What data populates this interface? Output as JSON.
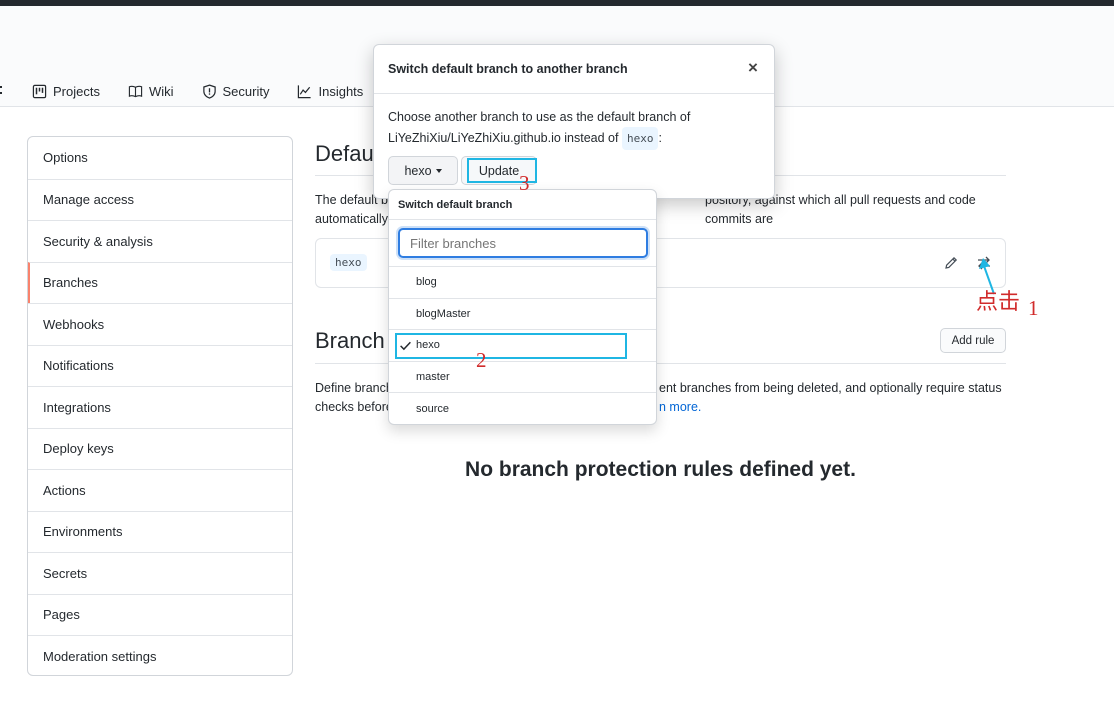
{
  "tabs": [
    {
      "label": "Projects",
      "icon": "project-icon"
    },
    {
      "label": "Wiki",
      "icon": "book-icon"
    },
    {
      "label": "Security",
      "icon": "shield-icon"
    },
    {
      "label": "Insights",
      "icon": "graph-icon"
    }
  ],
  "sidebar": {
    "items": [
      {
        "label": "Options"
      },
      {
        "label": "Manage access"
      },
      {
        "label": "Security & analysis"
      },
      {
        "label": "Branches",
        "selected": true
      },
      {
        "label": "Webhooks"
      },
      {
        "label": "Notifications"
      },
      {
        "label": "Integrations"
      },
      {
        "label": "Deploy keys"
      },
      {
        "label": "Actions"
      },
      {
        "label": "Environments"
      },
      {
        "label": "Secrets"
      },
      {
        "label": "Pages"
      },
      {
        "label": "Moderation settings"
      }
    ]
  },
  "default_branch": {
    "title_visible": "Defau",
    "desc_left_line1": "The default b",
    "desc_left_line2": "automatically",
    "desc_right_line1": "pository, against which all pull requests and code commits are",
    "branch_name": "hexo"
  },
  "protection": {
    "title_visible": "Branch",
    "add_rule_label": "Add rule",
    "desc_left_line1": "Define branch",
    "desc_left_line2": "checks before",
    "desc_right_line1": "ent branches from being deleted, and optionally require status",
    "learn_more_visible": "n more.",
    "blankslate": "No branch protection rules defined yet."
  },
  "modal": {
    "title": "Switch default branch to another branch",
    "close_glyph": "×",
    "body_line1": "Choose another branch to use as the default branch of",
    "body_line2_prefix": "LiYeZhiXiu/LiYeZhiXiu.github.io instead of",
    "current_branch": "hexo",
    "body_line2_suffix": ":",
    "select_label": "hexo",
    "update_label": "Update"
  },
  "dropdown": {
    "header": "Switch default branch",
    "filter_placeholder": "Filter branches",
    "branches": [
      {
        "name": "blog",
        "checked": false
      },
      {
        "name": "blogMaster",
        "checked": false
      },
      {
        "name": "hexo",
        "checked": true
      },
      {
        "name": "master",
        "checked": false
      },
      {
        "name": "source",
        "checked": false
      }
    ]
  },
  "annotations": {
    "step1_text": "点击",
    "step1_num": "1",
    "step2_num": "2",
    "step3_num": "3",
    "highlight_color": "#1fb6e3",
    "annotation_color": "#d12b2b"
  }
}
